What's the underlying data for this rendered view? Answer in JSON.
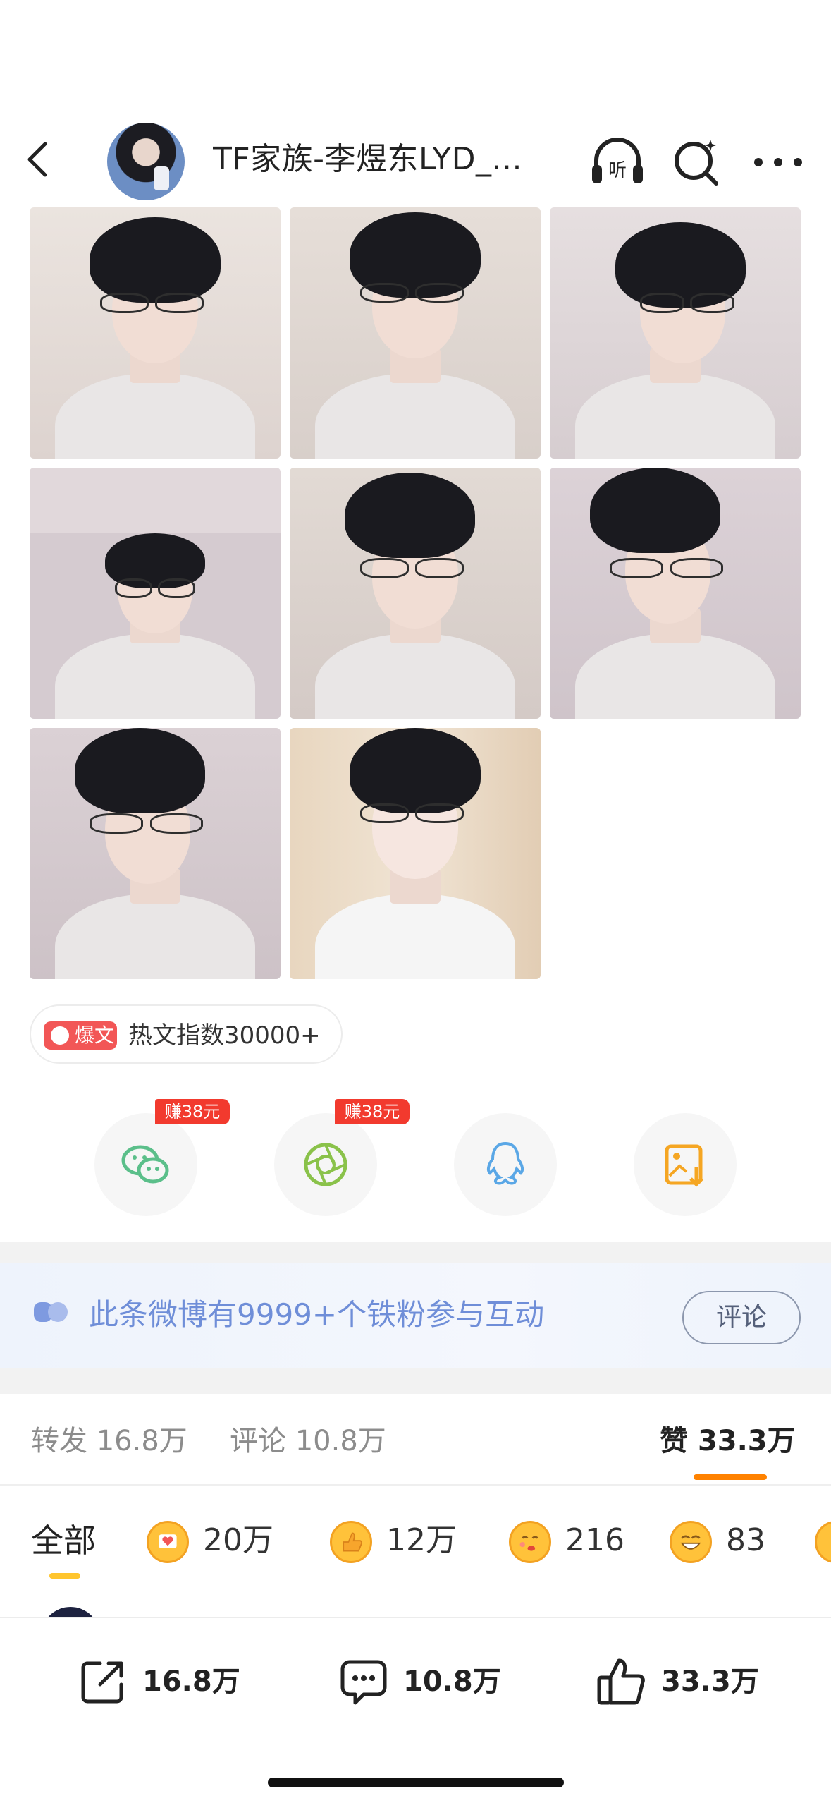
{
  "header": {
    "title": "TF家族-李煜东LYD_..."
  },
  "photos": [
    {
      "bg": "#e9e3df"
    },
    {
      "bg": "#e3dcd6"
    },
    {
      "bg": "#e2dadb"
    },
    {
      "bg": "#d9cfd3"
    },
    {
      "bg": "#dcd4cf"
    },
    {
      "bg": "#d7cdd2"
    },
    {
      "bg": "#d6ccd0"
    },
    {
      "bg": "#e4d5c1"
    }
  ],
  "hot_badge": {
    "tag": "爆文",
    "text": "热文指数30000+"
  },
  "share": {
    "wechat_earn": "赚38元",
    "moments_earn": "赚38元"
  },
  "fans_banner": {
    "text": "此条微博有9999+个铁粉参与互动",
    "button": "评论"
  },
  "stats": {
    "repost": "转发 16.8万",
    "comment": "评论 10.8万",
    "like_label": "赞",
    "like_count": "33.3万"
  },
  "reactions": {
    "all_label": "全部",
    "items": [
      {
        "count": "20万"
      },
      {
        "count": "12万"
      },
      {
        "count": "216"
      },
      {
        "count": "83"
      }
    ]
  },
  "bottom_bar": {
    "share_count": "16.8万",
    "comment_count": "10.8万",
    "like_count": "33.3万"
  },
  "colors": {
    "accent_orange": "#ff8200",
    "hot_red": "#f25656",
    "fans_blue": "#6f8ed8",
    "wechat_green": "#5bbf8a",
    "qq_blue": "#5aa7e6",
    "save_orange": "#f5a623"
  }
}
